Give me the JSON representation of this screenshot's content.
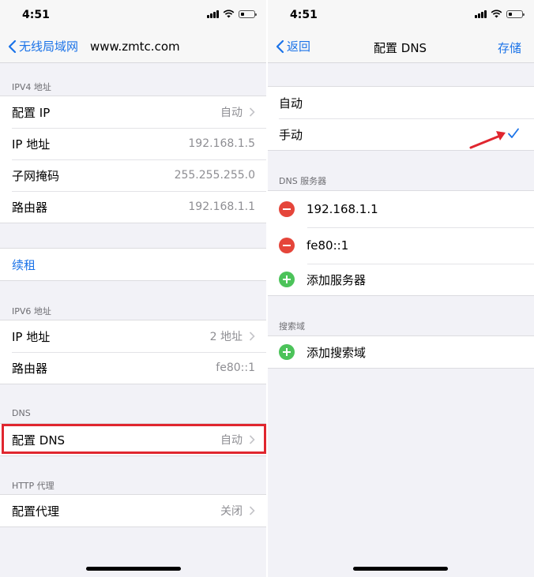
{
  "colors": {
    "accent": "#1b73e8",
    "delete": "#e5453a",
    "add": "#4cc35a",
    "highlight": "#e0262f"
  },
  "left": {
    "status": {
      "time": "4:51"
    },
    "nav": {
      "back_label": "无线局域网",
      "title": "www.zmtc.com"
    },
    "ipv4": {
      "header": "IPV4 地址",
      "rows": [
        {
          "label": "配置 IP",
          "value": "自动"
        },
        {
          "label": "IP 地址",
          "value": "192.168.1.5"
        },
        {
          "label": "子网掩码",
          "value": "255.255.255.0"
        },
        {
          "label": "路由器",
          "value": "192.168.1.1"
        }
      ]
    },
    "renew": {
      "label": "续租"
    },
    "ipv6": {
      "header": "IPV6 地址",
      "rows": [
        {
          "label": "IP 地址",
          "value": "2 地址"
        },
        {
          "label": "路由器",
          "value": "fe80::1"
        }
      ]
    },
    "dns": {
      "header": "DNS",
      "label": "配置 DNS",
      "value": "自动"
    },
    "proxy": {
      "header": "HTTP 代理",
      "label": "配置代理",
      "value": "关闭"
    }
  },
  "right": {
    "status": {
      "time": "4:51"
    },
    "nav": {
      "back_label": "返回",
      "title": "配置 DNS",
      "save_label": "存储"
    },
    "mode": {
      "auto_label": "自动",
      "manual_label": "手动",
      "selected": "手动"
    },
    "servers": {
      "header": "DNS 服务器",
      "items": [
        "192.168.1.1",
        "fe80::1"
      ],
      "add_label": "添加服务器"
    },
    "search": {
      "header": "搜索域",
      "add_label": "添加搜索域"
    }
  },
  "icons": [
    "chevron-left-icon",
    "chevron-right-icon",
    "cellular-signal-icon",
    "wifi-icon",
    "battery-icon",
    "checkmark-icon",
    "minus-circle-icon",
    "plus-circle-icon",
    "red-arrow-icon"
  ]
}
